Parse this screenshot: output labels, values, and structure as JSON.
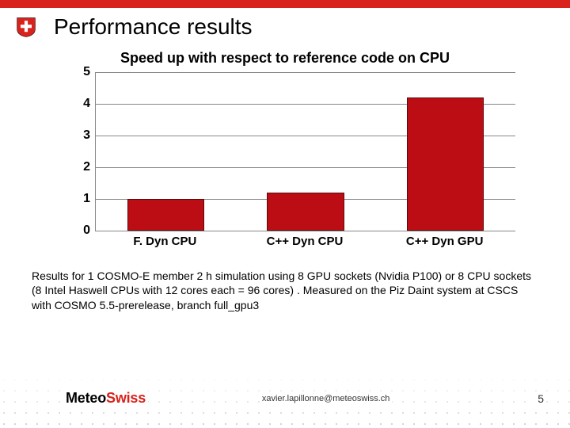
{
  "header": {
    "title": "Performance results",
    "subtitle": "Speed up with respect to reference code on CPU"
  },
  "chart_data": {
    "type": "bar",
    "categories": [
      "F. Dyn CPU",
      "C++ Dyn CPU",
      "C++ Dyn GPU"
    ],
    "values": [
      1.0,
      1.2,
      4.2
    ],
    "title": "Speed up with respect to reference code on CPU",
    "xlabel": "",
    "ylabel": "",
    "ylim": [
      0,
      5
    ],
    "yticks": [
      0,
      1,
      2,
      3,
      4,
      5
    ]
  },
  "caption": "Results for 1 COSMO-E member 2 h simulation using 8 GPU sockets (Nvidia P100) or 8 CPU sockets (8 Intel Haswell CPUs with 12 cores each = 96 cores) . Measured on the Piz Daint system at CSCS with COSMO 5.5-prerelease, branch full_gpu3",
  "footer": {
    "brand_prefix": "Meteo",
    "brand_suffix": "Swiss",
    "contact": "xavier.lapillonne@meteoswiss.ch",
    "page": "5"
  }
}
